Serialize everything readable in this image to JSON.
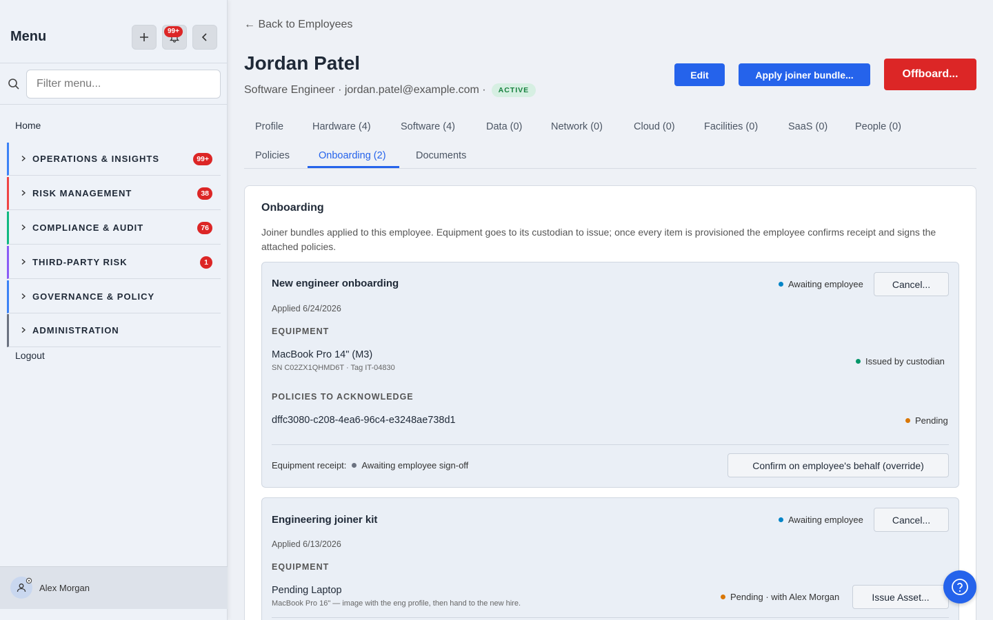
{
  "sidebar": {
    "title": "Menu",
    "notification_count": "99+",
    "search_placeholder": "Filter menu...",
    "home": "Home",
    "sections": [
      {
        "label": "OPERATIONS & INSIGHTS",
        "count": "99+",
        "color": "#3b82f6"
      },
      {
        "label": "RISK MANAGEMENT",
        "count": "38",
        "color": "#ef4444"
      },
      {
        "label": "COMPLIANCE & AUDIT",
        "count": "76",
        "color": "#10b981"
      },
      {
        "label": "THIRD-PARTY RISK",
        "count": "1",
        "color": "#8b5cf6"
      },
      {
        "label": "GOVERNANCE & POLICY",
        "count": "",
        "color": "#3b82f6"
      },
      {
        "label": "ADMINISTRATION",
        "count": "",
        "color": "#6b7280"
      }
    ],
    "logout": "Logout",
    "user": {
      "name": "Alex Morgan"
    }
  },
  "header": {
    "back_link": "← Back to Employees",
    "name": "Jordan Patel",
    "subtitle": "Software Engineer · jordan.patel@example.com ·",
    "status_badge": "ACTIVE",
    "edit_label": "Edit",
    "apply_bundle_label": "Apply joiner bundle...",
    "offboard_label": "Offboard..."
  },
  "tabs": {
    "row1": [
      "Profile",
      "Hardware (4)",
      "Software (4)",
      "Data (0)",
      "Network (0)",
      "Cloud (0)",
      "Facilities (0)",
      "SaaS (0)",
      "People (0)"
    ],
    "row2": [
      "Policies",
      "Onboarding (2)",
      "Documents"
    ],
    "active": "Onboarding (2)"
  },
  "onboarding": {
    "title": "Onboarding",
    "description": "Joiner bundles applied to this employee. Equipment goes to its custodian to issue; once every item is provisioned the employee confirms receipt and signs the attached policies.",
    "bundles": [
      {
        "name": "New engineer onboarding",
        "status": "Awaiting employee",
        "cancel_label": "Cancel...",
        "applied": "Applied 6/24/2026",
        "equipment_heading": "EQUIPMENT",
        "equipment": [
          {
            "name": "MacBook Pro 14\" (M3)",
            "detail": "SN C02ZX1QHMD6T · Tag IT-04830",
            "status": "Issued by custodian"
          }
        ],
        "policies_heading": "POLICIES TO ACKNOWLEDGE",
        "policies": [
          {
            "id": "dffc3080-c208-4ea6-96c4-e3248ae738d1",
            "status": "Pending"
          }
        ],
        "receipt_label": "Equipment receipt:",
        "receipt_status": "Awaiting employee sign-off",
        "override_label": "Confirm on employee's behalf (override)"
      },
      {
        "name": "Engineering joiner kit",
        "status": "Awaiting employee",
        "cancel_label": "Cancel...",
        "applied": "Applied 6/13/2026",
        "equipment_heading": "EQUIPMENT",
        "equipment": [
          {
            "name": "Pending Laptop",
            "detail": "MacBook Pro 16\" — image with the eng profile, then hand to the new hire.",
            "status": "Pending · with Alex Morgan",
            "action_label": "Issue Asset..."
          }
        ]
      }
    ]
  },
  "colors": {
    "accent": "#2563eb",
    "danger": "#dc2626",
    "success": "#15803d"
  }
}
